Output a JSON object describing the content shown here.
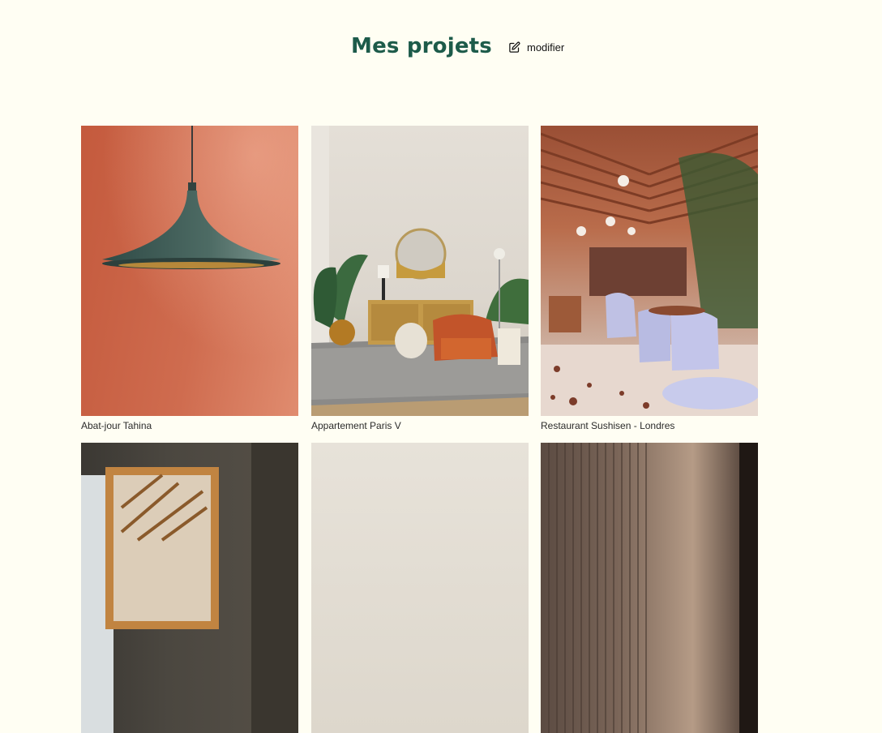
{
  "header": {
    "title": "Mes projets",
    "edit_label": "modifier",
    "edit_icon": "edit-icon"
  },
  "projects": [
    {
      "label": "Abat-jour Tahina"
    },
    {
      "label": "Appartement Paris V"
    },
    {
      "label": "Restaurant Sushisen - Londres"
    },
    {
      "label": ""
    },
    {
      "label": ""
    },
    {
      "label": ""
    }
  ],
  "colors": {
    "background": "#fffef3",
    "title": "#1d5b4a"
  }
}
